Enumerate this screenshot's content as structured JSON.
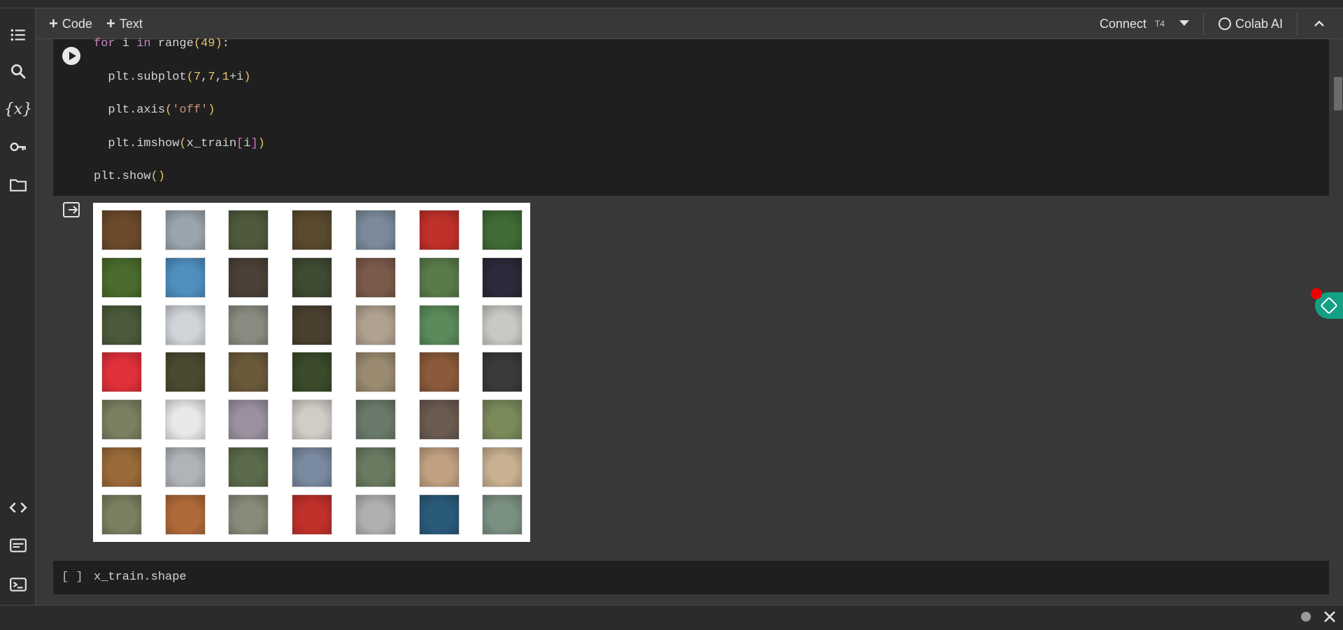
{
  "toolbar": {
    "code_label": "Code",
    "text_label": "Text",
    "connect_label": "Connect",
    "runtime_label": "T4",
    "colab_ai_label": "Colab AI"
  },
  "cell1": {
    "lines": [
      {
        "pre": "",
        "kw": "for",
        "mid": " i ",
        "kw2": "in",
        "rest1": " range",
        "p1": "(",
        "n1": "49",
        "p2": ")",
        "tail": ":"
      },
      {
        "text_a": "  plt.subplot",
        "p1": "(",
        "n1": "7",
        "c1": ",",
        "n2": "7",
        "c2": ",",
        "n3": "1",
        "tail": "+i",
        "p2": ")"
      },
      {
        "text_a": "  plt.axis",
        "p1": "(",
        "s1": "'off'",
        "p2": ")"
      },
      {
        "text_a": "  plt.imshow",
        "p1": "(",
        "b1": "x_train",
        "b2": "[",
        "b3": "i",
        "b4": "]",
        "p2": ")"
      },
      {
        "text_a": "plt.show",
        "p1": "(",
        "p2": ")"
      }
    ]
  },
  "output": {
    "grid_rows": 7,
    "grid_cols": 7,
    "thumb_colors": [
      [
        "#6b4a2b",
        "#9aa4ad",
        "#4f5a3c",
        "#5a4a2e",
        "#7a8a9a",
        "#c0302a",
        "#3f6b34"
      ],
      [
        "#4a6b2c",
        "#4f8fc0",
        "#4a4035",
        "#3e4a32",
        "#7a5a4a",
        "#5a7a4a",
        "#2a2a3a"
      ],
      [
        "#4a5a3a",
        "#d0d4d8",
        "#8a8a80",
        "#4a4030",
        "#b0a090",
        "#5a8a5a",
        "#c8c8c4"
      ],
      [
        "#e0303a",
        "#4a4a30",
        "#6a5a3a",
        "#3a4a2a",
        "#9a8a70",
        "#8a5a3a",
        "#3a3a3a"
      ],
      [
        "#7a8060",
        "#e8e8ea",
        "#9a90a0",
        "#d0ccc6",
        "#6a7a6a",
        "#6a5a50",
        "#7a8a5a"
      ],
      [
        "#9a6a3a",
        "#b0b4b8",
        "#5a6a4a",
        "#7a8aa0",
        "#6a7a60",
        "#c0a080",
        "#c8b090"
      ],
      [
        "#7a8060",
        "#b06a3a",
        "#8a8a7a",
        "#c0302a",
        "#b0b0b0",
        "#2a5a7a",
        "#7a9080"
      ]
    ]
  },
  "cell2": {
    "bracket_label": "[ ]",
    "code": "x_train.shape"
  },
  "icons": [
    "toc-icon",
    "search-icon",
    "variables-icon",
    "key-icon",
    "folder-icon",
    "code-snippets-icon",
    "command-palette-icon",
    "terminal-icon"
  ]
}
